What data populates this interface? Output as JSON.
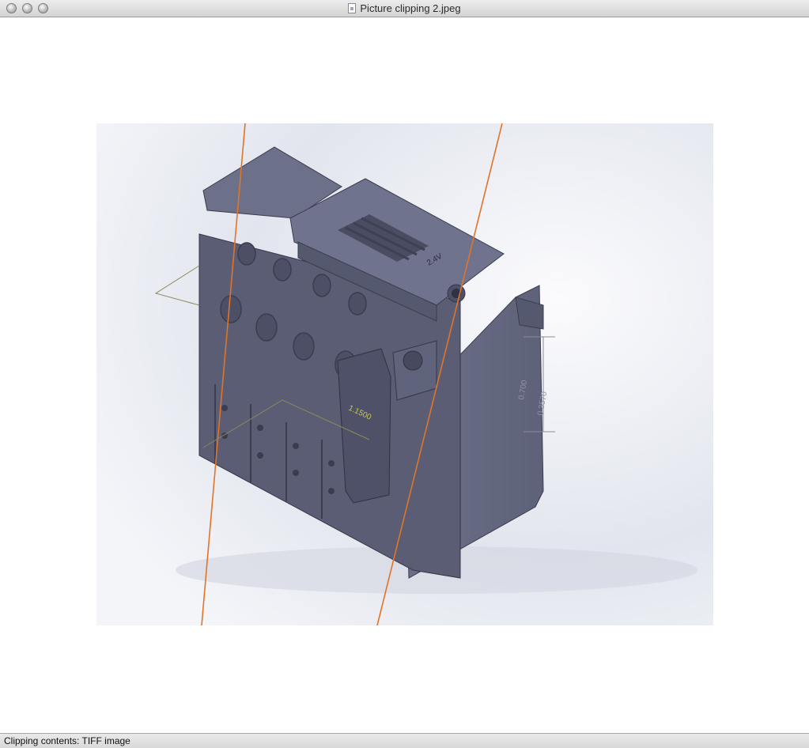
{
  "window": {
    "title": "Picture clipping 2.jpeg",
    "file_icon": "document-icon"
  },
  "image": {
    "content": "3D CAD model of engine block with orange section lines",
    "dim_labels": [
      "1.1500",
      "0.3570",
      "0.700"
    ],
    "embossed_text": [
      "2.4V"
    ],
    "accent_colors": {
      "section_line": "#e07428",
      "model": "#5c6079",
      "dimension": "#8a8a5a"
    }
  },
  "status": {
    "text": "Clipping contents: TIFF image"
  }
}
